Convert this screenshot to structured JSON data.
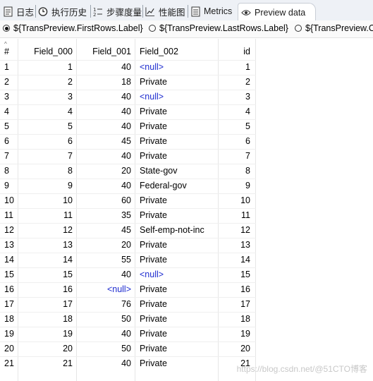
{
  "tabs": [
    {
      "label": "日志",
      "icon": "log-icon"
    },
    {
      "label": "执行历史",
      "icon": "history-icon"
    },
    {
      "label": "步骤度量",
      "icon": "step-metrics-icon"
    },
    {
      "label": "性能图",
      "icon": "performance-chart-icon"
    },
    {
      "label": "Metrics",
      "icon": "metrics-icon"
    },
    {
      "label": "Preview data",
      "icon": "preview-eye-icon",
      "active": true
    }
  ],
  "radios": [
    {
      "label": "${TransPreview.FirstRows.Label}",
      "checked": true
    },
    {
      "label": "${TransPreview.LastRows.Label}",
      "checked": false
    },
    {
      "label": "${TransPreview.O",
      "checked": false
    }
  ],
  "table": {
    "headers": [
      "#",
      "Field_000",
      "Field_001",
      "Field_002",
      "id"
    ],
    "rows": [
      [
        "1",
        "1",
        "40",
        "<null>",
        "1"
      ],
      [
        "2",
        "2",
        "18",
        "Private",
        "2"
      ],
      [
        "3",
        "3",
        "40",
        "<null>",
        "3"
      ],
      [
        "4",
        "4",
        "40",
        "Private",
        "4"
      ],
      [
        "5",
        "5",
        "40",
        "Private",
        "5"
      ],
      [
        "6",
        "6",
        "45",
        "Private",
        "6"
      ],
      [
        "7",
        "7",
        "40",
        "Private",
        "7"
      ],
      [
        "8",
        "8",
        "20",
        "State-gov",
        "8"
      ],
      [
        "9",
        "9",
        "40",
        "Federal-gov",
        "9"
      ],
      [
        "10",
        "10",
        "60",
        "Private",
        "10"
      ],
      [
        "11",
        "11",
        "35",
        "Private",
        "11"
      ],
      [
        "12",
        "12",
        "45",
        "Self-emp-not-inc",
        "12"
      ],
      [
        "13",
        "13",
        "20",
        "Private",
        "13"
      ],
      [
        "14",
        "14",
        "55",
        "Private",
        "14"
      ],
      [
        "15",
        "15",
        "40",
        "<null>",
        "15"
      ],
      [
        "16",
        "16",
        "<null>",
        "Private",
        "16"
      ],
      [
        "17",
        "17",
        "76",
        "Private",
        "17"
      ],
      [
        "18",
        "18",
        "50",
        "Private",
        "18"
      ],
      [
        "19",
        "19",
        "40",
        "Private",
        "19"
      ],
      [
        "20",
        "20",
        "50",
        "Private",
        "20"
      ],
      [
        "21",
        "21",
        "40",
        "Private",
        "21"
      ]
    ]
  },
  "watermark": "https://blog.csdn.net/@51CTO博客",
  "colors": {
    "null_value": "#1e2ccf",
    "tab_bar": "#eef1f6"
  }
}
